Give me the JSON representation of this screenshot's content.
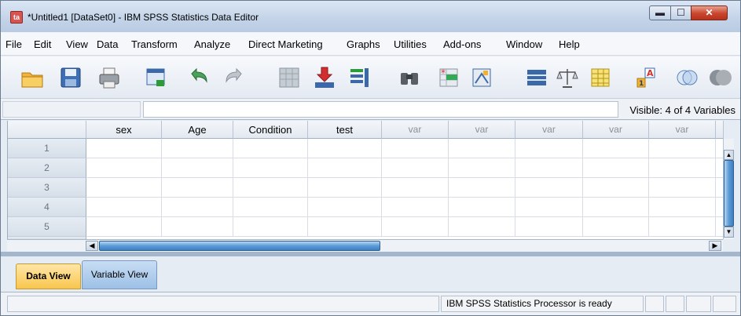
{
  "window": {
    "title": "*Untitled1 [DataSet0] - IBM SPSS Statistics Data Editor",
    "app_icon_text": "ta",
    "minimize_label": "▬",
    "maximize_label": "☐",
    "close_label": "✕"
  },
  "menu": [
    "File",
    "Edit",
    "View",
    "Data",
    "Transform",
    "Analyze",
    "Direct Marketing",
    "Graphs",
    "Utilities",
    "Add-ons",
    "Window",
    "Help"
  ],
  "toolbar_icons": [
    "open-folder-icon",
    "save-icon",
    "print-icon",
    "recall-dialog-icon",
    "undo-icon",
    "redo-icon",
    "go-to-case-icon",
    "go-to-variable-icon",
    "variables-icon",
    "find-icon",
    "insert-cases-icon",
    "insert-variable-icon",
    "split-file-icon",
    "weight-cases-icon",
    "select-cases-icon",
    "value-labels-icon",
    "use-variable-sets-icon",
    "show-all-variables-icon"
  ],
  "cellbar": {
    "cell_ref": "",
    "cell_value": "",
    "visible": "Visible: 4 of 4 Variables"
  },
  "grid": {
    "columns": [
      "sex",
      "Age",
      "Condition",
      "test",
      "var",
      "var",
      "var",
      "var",
      "var"
    ],
    "rows": [
      "1",
      "2",
      "3",
      "4",
      "5"
    ]
  },
  "scroll": {
    "left_arrow": "◀",
    "right_arrow": "▶",
    "up_arrow": "▲",
    "down_arrow": "▼"
  },
  "tabs": {
    "data_view": "Data View",
    "variable_view": "Variable View",
    "active": "Data View"
  },
  "status": {
    "text": "IBM SPSS Statistics Processor is ready"
  },
  "colors": {
    "active_tab": "#f8c64d",
    "inactive_tab": "#9dc0e6",
    "scroll_thumb": "#5d9bd6"
  }
}
